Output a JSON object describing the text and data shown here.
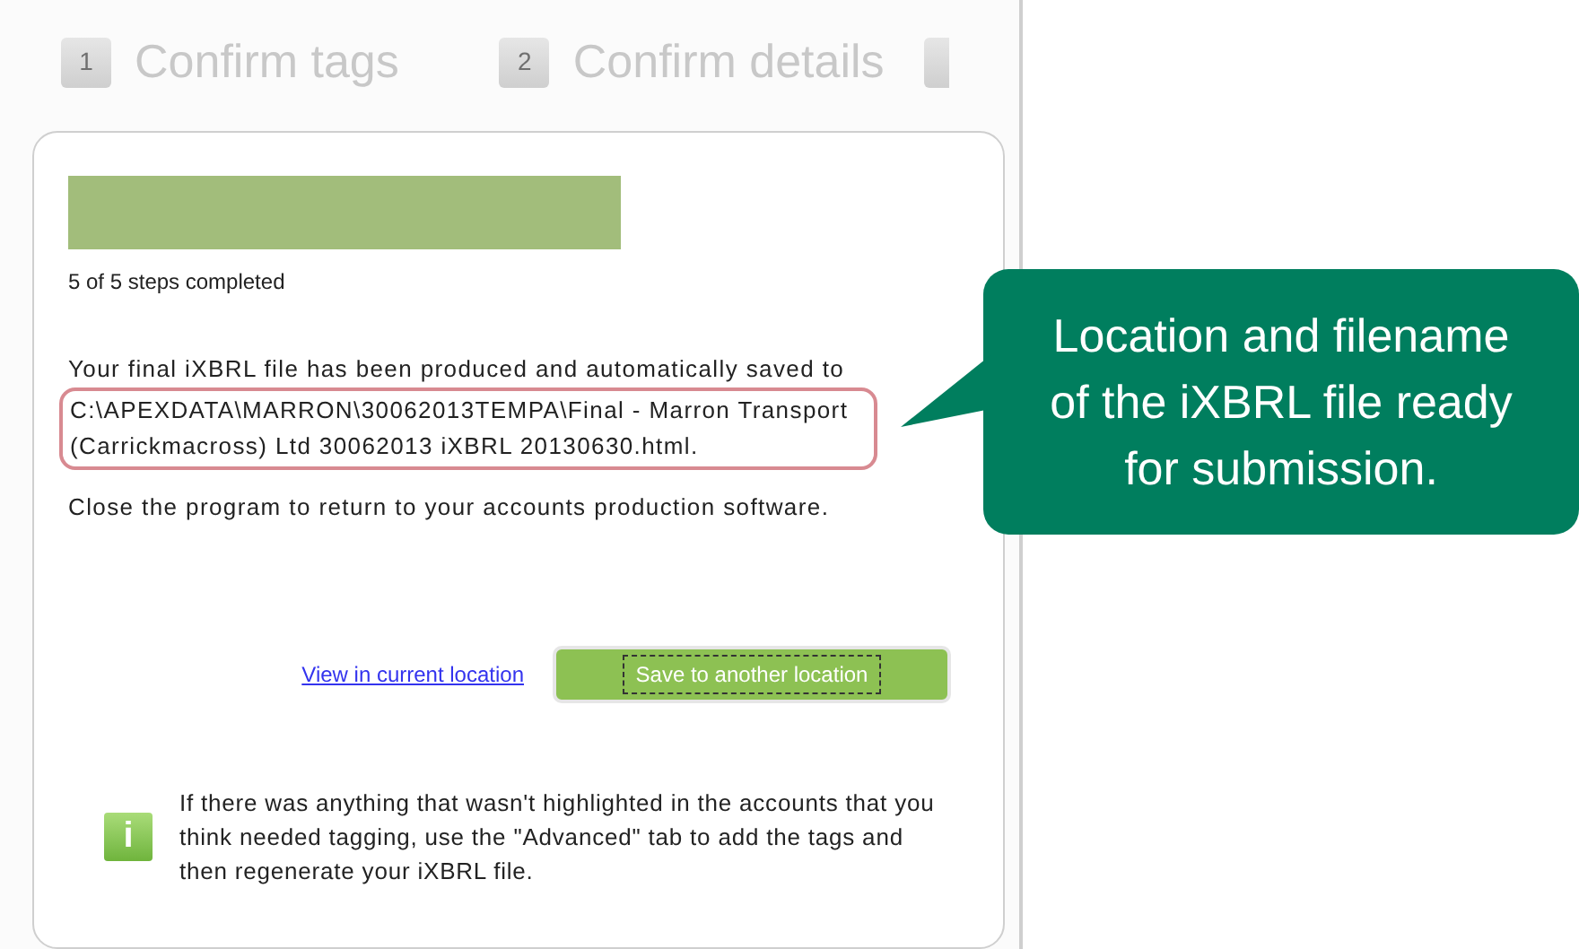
{
  "steps": [
    {
      "number": "1",
      "label": "Confirm tags"
    },
    {
      "number": "2",
      "label": "Confirm details"
    }
  ],
  "progress": {
    "caption": "5 of 5 steps completed"
  },
  "message": "Your final iXBRL file has been produced and automatically saved to",
  "file_path": "C:\\APEXDATA\\MARRON\\30062013TEMPA\\Final - Marron Transport (Carrickmacross) Ltd 30062013 iXBRL 20130630.html.",
  "instruction": "Close the program to return to your accounts production software.",
  "view_link": "View in current location",
  "save_button": "Save to another location",
  "info_icon": "i",
  "info_text": "If there was anything that wasn't highlighted in the accounts that you think needed tagging, use the \"Advanced\" tab to add the tags and then regenerate your iXBRL file.",
  "callout": "Location and filename of the iXBRL file ready for submission."
}
